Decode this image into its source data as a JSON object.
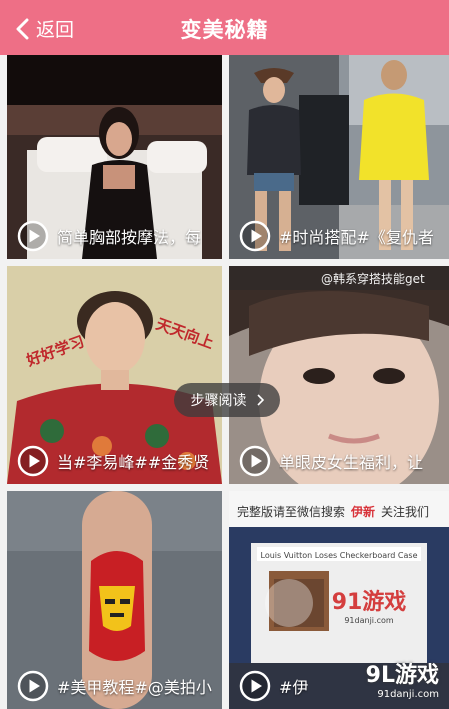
{
  "header": {
    "back_label": "返回",
    "title": "变美秘籍"
  },
  "cards": [
    {
      "caption": "简单胸部按摩法，每"
    },
    {
      "caption": "#时尚搭配#《复仇者"
    },
    {
      "caption": "当#李易峰##金秀贤",
      "overlay_left": "好好学习",
      "overlay_right": "天天向上"
    },
    {
      "caption": "单眼皮女生福利，让",
      "overlay_top": "@韩系穿搭技能get"
    },
    {
      "caption": "#美甲教程#@美拍小"
    },
    {
      "caption": "#伊",
      "banner_prefix": "完整版请至微信搜索",
      "banner_brand": "伊新",
      "banner_suffix": "关注我们",
      "overlay_sign": "Louis Vuitton Loses Checkerboard Case",
      "overlay_logo": "91游戏",
      "overlay_url": "91danji.com"
    }
  ],
  "tooltip": {
    "label": "步骤阅读"
  },
  "watermark": {
    "logo": "9L游戏",
    "url": "91danji.com"
  },
  "colors": {
    "header": "#ee6f86",
    "text_on_header": "#ffffff"
  }
}
